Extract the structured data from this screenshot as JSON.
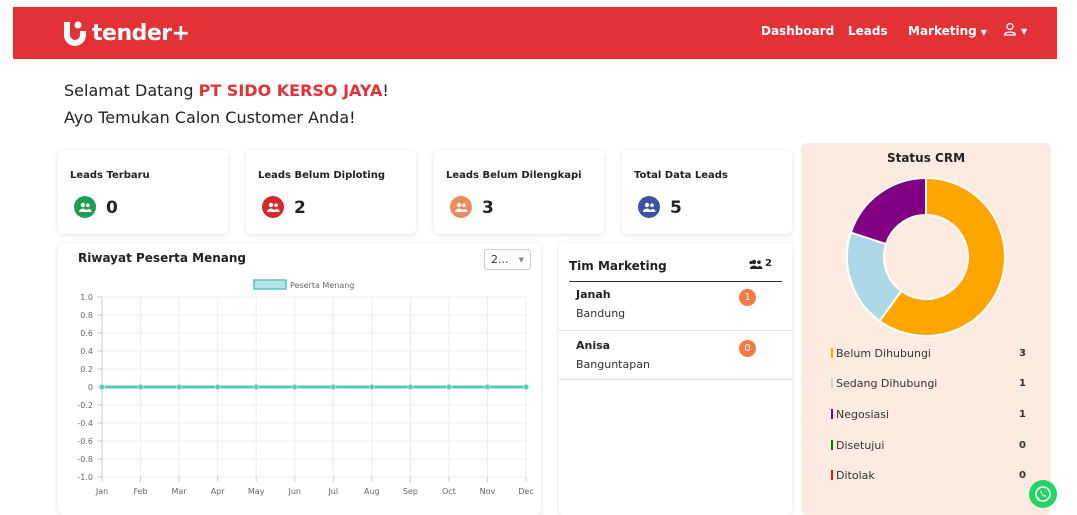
{
  "brand": {
    "name": "tender+"
  },
  "nav": {
    "dashboard": "Dashboard",
    "leads": "Leads",
    "marketing": "Marketing"
  },
  "greeting": {
    "prefix": "Selamat Datang ",
    "company": "PT SIDO KERSO JAYA",
    "suffix": "!",
    "subtitle": "Ayo Temukan Calon Customer Anda!"
  },
  "stats": [
    {
      "title": "Leads Terbaru",
      "value": "0",
      "color": "#1f9d57"
    },
    {
      "title": "Leads Belum Diploting",
      "value": "2",
      "color": "#d42a2a"
    },
    {
      "title": "Leads Belum Dilengkapi",
      "value": "3",
      "color": "#ef8a5c"
    },
    {
      "title": "Total Data Leads",
      "value": "5",
      "color": "#3f51a3"
    }
  ],
  "history": {
    "title": "Riwayat Peserta Menang",
    "year_select": "2..."
  },
  "chart_data": {
    "type": "line",
    "categories": [
      "Jan",
      "Feb",
      "Mar",
      "Apr",
      "May",
      "Jun",
      "Jul",
      "Aug",
      "Sep",
      "Oct",
      "Nov",
      "Dec"
    ],
    "series": [
      {
        "name": "Peserta Menang",
        "values": [
          0,
          0,
          0,
          0,
          0,
          0,
          0,
          0,
          0,
          0,
          0,
          0
        ]
      }
    ],
    "y_ticks": [
      "1.0",
      "0.8",
      "0.6",
      "0.4",
      "0.2",
      "0",
      "-0.2",
      "-0.4",
      "-0.6",
      "-0.8",
      "-1.0"
    ],
    "ylim": [
      -1.0,
      1.0
    ],
    "color": "#5bc4bf",
    "legend": "top",
    "grid": true
  },
  "team": {
    "title": "Tim Marketing",
    "count": "2",
    "members": [
      {
        "name": "Janah",
        "city": "Bandung",
        "badge": "1"
      },
      {
        "name": "Anisa",
        "city": "Banguntapan",
        "badge": "0"
      }
    ]
  },
  "crm": {
    "title": "Status CRM",
    "segments": [
      {
        "label": "Belum Dihubungi",
        "count": "3",
        "value": 3,
        "color": "#ffa500"
      },
      {
        "label": "Sedang Dihubungi",
        "count": "1",
        "value": 1,
        "color": "#add8e6"
      },
      {
        "label": "Negosiasi",
        "count": "1",
        "value": 1,
        "color": "#800080"
      },
      {
        "label": "Disetujui",
        "count": "0",
        "value": 0,
        "color": "#008000"
      },
      {
        "label": "Ditolak",
        "count": "0",
        "value": 0,
        "color": "#e81515"
      }
    ]
  },
  "icons": {
    "logo": "tender-logo-icon",
    "user": "user-icon",
    "group": "users-icon",
    "whatsapp": "whatsapp-icon"
  }
}
